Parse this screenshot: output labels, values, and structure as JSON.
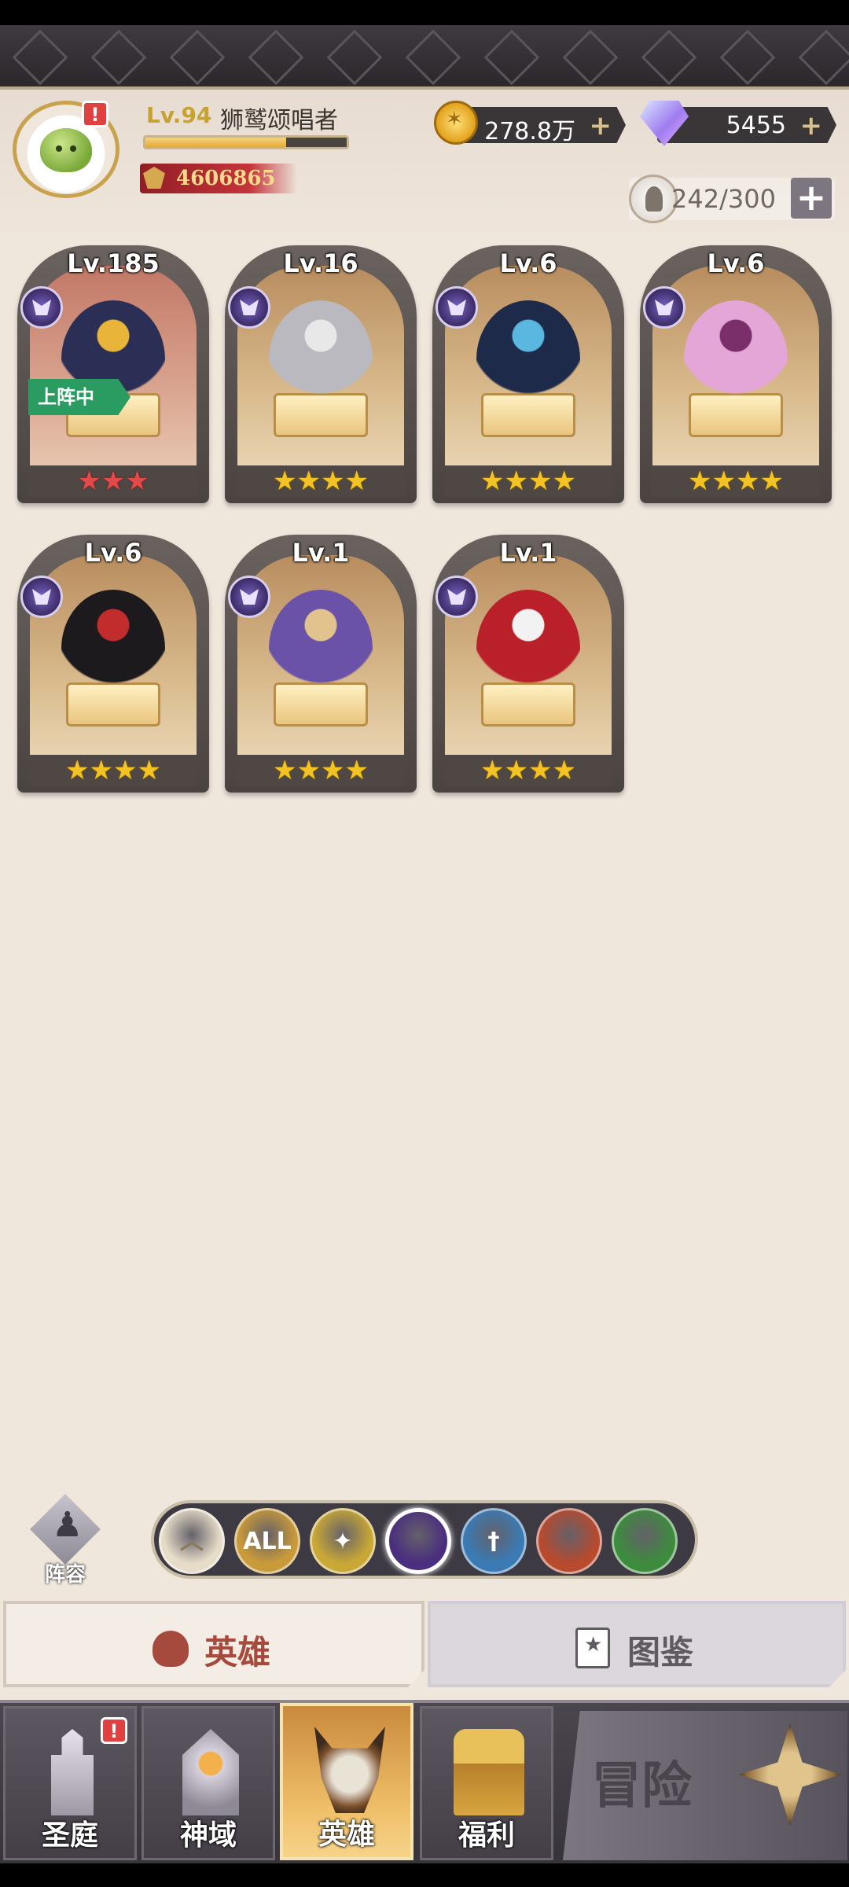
{
  "player": {
    "level": "Lv.94",
    "name": "狮鹫颂唱者",
    "xp_fraction": 0.7,
    "power": "4606865",
    "avatar_icon": "slime-avatar-icon",
    "alert": "!"
  },
  "currency": {
    "gold": "278.8万",
    "gems": "5455",
    "plus": "+"
  },
  "capacity": {
    "value": "242/300",
    "plus": "+"
  },
  "heroes": [
    {
      "level": "Lv.185",
      "stars": "★★★",
      "star_color": "red",
      "deployed": true,
      "deployed_label": "上阵中",
      "bg": "red",
      "sprite_color": "#2b2f55",
      "accent": "#e8b43a"
    },
    {
      "level": "Lv.16",
      "stars": "★★★★",
      "star_color": "gold",
      "deployed": false,
      "bg": "brown",
      "sprite_color": "#b9b9bf",
      "accent": "#e8e8e8"
    },
    {
      "level": "Lv.6",
      "stars": "★★★★",
      "star_color": "gold",
      "deployed": false,
      "bg": "brown",
      "sprite_color": "#1d2a4a",
      "accent": "#59b7e0"
    },
    {
      "level": "Lv.6",
      "stars": "★★★★",
      "star_color": "gold",
      "deployed": false,
      "bg": "brown",
      "sprite_color": "#e4a6d6",
      "accent": "#7a2e6a"
    },
    {
      "level": "Lv.6",
      "stars": "★★★★",
      "star_color": "gold",
      "deployed": false,
      "bg": "brown",
      "sprite_color": "#1c1a1d",
      "accent": "#c32c2c"
    },
    {
      "level": "Lv.1",
      "stars": "★★★★",
      "star_color": "gold",
      "deployed": false,
      "bg": "brown",
      "sprite_color": "#6a52a8",
      "accent": "#e2c38e"
    },
    {
      "level": "Lv.1",
      "stars": "★★★★",
      "star_color": "gold",
      "deployed": false,
      "bg": "brown",
      "sprite_color": "#b9202a",
      "accent": "#f2f2f2"
    }
  ],
  "lineup": {
    "label": "阵容"
  },
  "filters": [
    {
      "name": "collapse",
      "label": "︿",
      "color": "#e6dcc8",
      "active": false
    },
    {
      "name": "all",
      "label": "ALL",
      "color": "#c99a3a",
      "active": false
    },
    {
      "name": "light",
      "label": "✦",
      "color": "#c9a836",
      "active": false
    },
    {
      "name": "dark",
      "label": "",
      "color": "#4a2f7e",
      "active": true
    },
    {
      "name": "holy",
      "label": "†",
      "color": "#3a7bb5",
      "active": false
    },
    {
      "name": "beast",
      "label": "",
      "color": "#b84a2e",
      "active": false
    },
    {
      "name": "nature",
      "label": "",
      "color": "#3d8c3e",
      "active": false
    }
  ],
  "tabs": {
    "hero": "英雄",
    "codex": "图鉴"
  },
  "nav": {
    "court": "圣庭",
    "domain": "神域",
    "hero": "英雄",
    "welfare": "福利",
    "adventure": "冒险",
    "court_alert": "!"
  }
}
